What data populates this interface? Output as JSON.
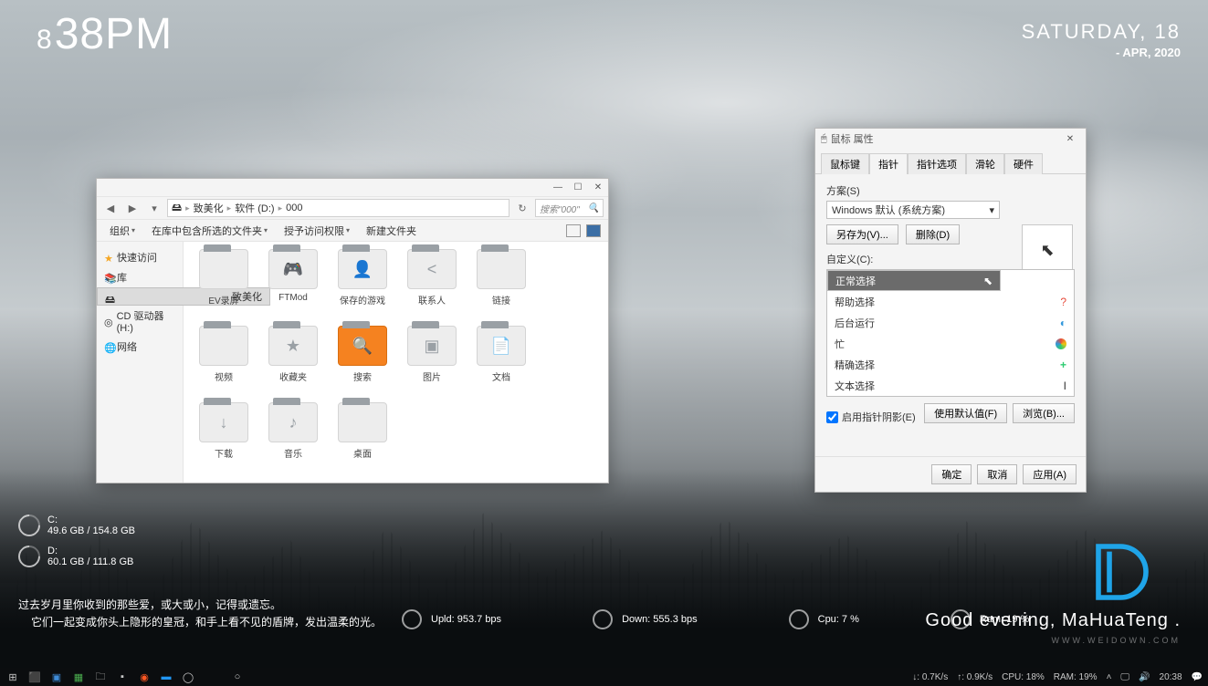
{
  "clock": {
    "hour_prefix": "8",
    "minute": "38",
    "ampm": "PM"
  },
  "date": {
    "day_line": "SATURDAY, 18",
    "month_line": "- APR, 2020"
  },
  "drives": [
    {
      "label": "C:",
      "usage": "49.6 GB / 154.8 GB"
    },
    {
      "label": "D:",
      "usage": "60.1 GB / 111.8 GB"
    }
  ],
  "quote": {
    "line1": "过去岁月里你收到的那些爱，或大或小，记得或遗忘。",
    "line2": "它们一起变成你头上隐形的皇冠，和手上看不见的盾牌，发出温柔的光。"
  },
  "netstats": [
    {
      "label": "Upld: 953.7 bps"
    },
    {
      "label": "Down: 555.3 bps"
    },
    {
      "label": "Cpu: 7 %"
    },
    {
      "label": "Ram: 19 %"
    }
  ],
  "greeting": "Good evening, MaHuaTeng .",
  "watermark": "WWW.WEIDOWN.COM",
  "explorer": {
    "breadcrumb": [
      "致美化",
      "软件 (D:)",
      "000"
    ],
    "search_placeholder": "搜索\"000\"",
    "toolbar": {
      "organize": "组织",
      "include": "在库中包含所选的文件夹",
      "share": "授予访问权限",
      "newfolder": "新建文件夹"
    },
    "sidebar": [
      {
        "label": "快速访问",
        "icon": "star"
      },
      {
        "label": "库",
        "icon": "lib"
      },
      {
        "label": "致美化",
        "icon": "disk",
        "selected": true
      },
      {
        "label": "CD 驱动器 (H:)",
        "icon": "cd"
      },
      {
        "label": "网络",
        "icon": "net"
      }
    ],
    "files": [
      {
        "label": "EV录屏",
        "glyph": ""
      },
      {
        "label": "FTMod",
        "glyph": "🎮"
      },
      {
        "label": "保存的游戏",
        "glyph": "👤"
      },
      {
        "label": "联系人",
        "glyph": "<"
      },
      {
        "label": "链接",
        "glyph": ""
      },
      {
        "label": "视频",
        "glyph": ""
      },
      {
        "label": "收藏夹",
        "glyph": "★"
      },
      {
        "label": "搜索",
        "glyph": "🔍",
        "orange": true
      },
      {
        "label": "图片",
        "glyph": "▣"
      },
      {
        "label": "文档",
        "glyph": "📄"
      },
      {
        "label": "下载",
        "glyph": "↓"
      },
      {
        "label": "音乐",
        "glyph": "♪"
      },
      {
        "label": "桌面",
        "glyph": ""
      }
    ]
  },
  "mouse": {
    "title": "鼠标 属性",
    "tabs": [
      "鼠标键",
      "指针",
      "指针选项",
      "滑轮",
      "硬件"
    ],
    "active_tab": 1,
    "scheme_label": "方案(S)",
    "scheme_value": "Windows 默认 (系统方案)",
    "save_as": "另存为(V)...",
    "delete": "删除(D)",
    "custom_label": "自定义(C):",
    "list": [
      {
        "label": "正常选择",
        "icon": "⬉",
        "selected": true
      },
      {
        "label": "帮助选择",
        "icon": "?"
      },
      {
        "label": "后台运行",
        "icon": "◐"
      },
      {
        "label": "忙",
        "icon": "●"
      },
      {
        "label": "精确选择",
        "icon": "+"
      },
      {
        "label": "文本选择",
        "icon": "I"
      }
    ],
    "shadow": "启用指针阴影(E)",
    "use_default": "使用默认值(F)",
    "browse": "浏览(B)...",
    "ok": "确定",
    "cancel": "取消",
    "apply": "应用(A)"
  },
  "taskbar": {
    "tray": {
      "net_down": "↓: 0.7K/s",
      "net_up": "↑: 0.9K/s",
      "cpu": "CPU: 18%",
      "ram": "RAM: 19%",
      "time": "20:38"
    }
  }
}
